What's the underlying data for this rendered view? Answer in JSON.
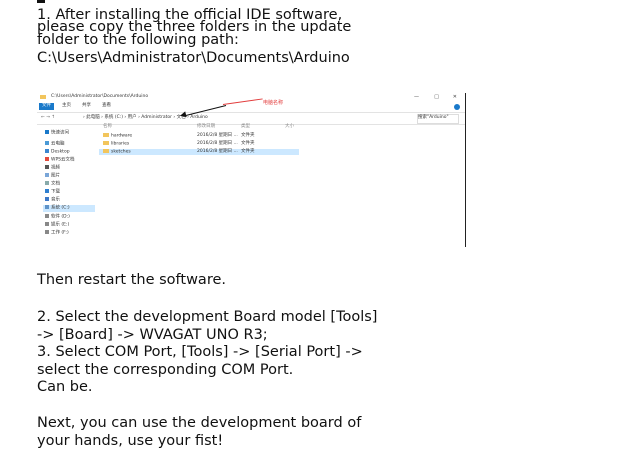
{
  "step1": {
    "line1": "1. After installing the official IDE software,",
    "line2": "please copy the three folders in the update",
    "line3": "folder to the following path:",
    "line4": "C:\\Users\\Administrator\\Documents\\Arduino"
  },
  "explorer": {
    "title_path": "C:\\Users\\Administrator\\Documents\\Arduino",
    "ribbon_tabs": [
      "文件",
      "主页",
      "共享",
      "查看"
    ],
    "window_controls": [
      "—",
      "□",
      "✕"
    ],
    "nav_glyphs": "←  →  ↑",
    "breadcrumb": "› 此电脑 › 系统 (C:) › 用户 › Administrator › 文档 › Arduino",
    "search_placeholder": "搜索\"Arduino\"",
    "annotation": "电脑名称",
    "sidebar": [
      "快速访问",
      "云电脑",
      "Desktop",
      "WPS云文档",
      "视频",
      "图片",
      "文档",
      "下载",
      "音乐",
      "系统 (C:)",
      "软件 (D:)",
      "娱乐 (E:)",
      "工作 (F:)"
    ],
    "columns": [
      "名称",
      "修改日期",
      "类型",
      "大小"
    ],
    "rows": [
      {
        "name": "hardware",
        "date": "2016/2/8 星期日 ...",
        "type": "文件夹"
      },
      {
        "name": "libraries",
        "date": "2016/2/8 星期日 ...",
        "type": "文件夹"
      },
      {
        "name": "sketches",
        "date": "2016/2/8 星期日 ...",
        "type": "文件夹"
      }
    ]
  },
  "restart": "Then restart the software.",
  "step2": {
    "line1": "2. Select the development Board model [Tools]",
    "line2": "-> [Board] -> WVAGAT UNO R3;"
  },
  "step3": {
    "line1": "3. Select COM Port, [Tools] -> [Serial Port] ->",
    "line2": "select the corresponding COM Port.",
    "line3": "Can be."
  },
  "closing": {
    "line1": "Next, you can use the development board of",
    "line2": "your hands, use your fist!"
  },
  "colors": {
    "selection": "#cce8ff",
    "accent": "#1979ca",
    "annotation": "#e23c3c",
    "folder": "#f2c55c"
  }
}
